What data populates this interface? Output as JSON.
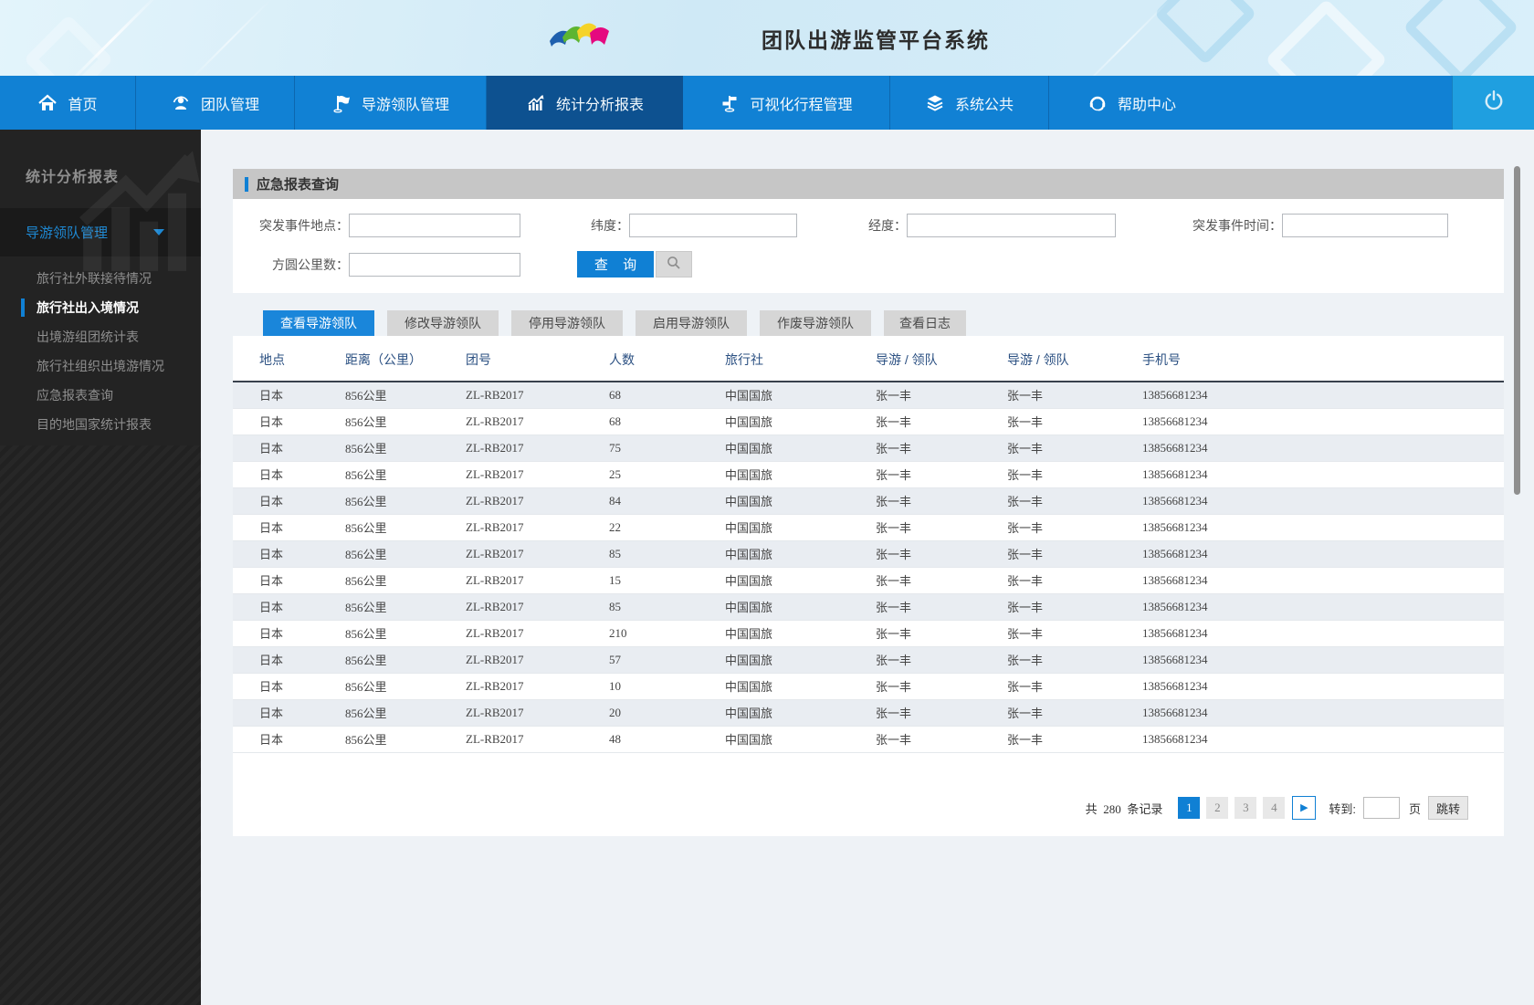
{
  "header": {
    "title": "团队出游监管平台系统"
  },
  "colors": {
    "accent": "#1080d4",
    "navbar": "#1181d4",
    "nav_active": "#0d5190",
    "power_section": "#1f9fe0",
    "sidebar_bg": "#232323",
    "panel_header_bg": "#c6c6c6"
  },
  "nav": {
    "items": [
      {
        "label": "首页",
        "icon": "home-icon",
        "active": false
      },
      {
        "label": "团队管理",
        "icon": "team-icon",
        "active": false
      },
      {
        "label": "导游领队管理",
        "icon": "flag-icon",
        "active": false
      },
      {
        "label": "统计分析报表",
        "icon": "chart-icon",
        "active": true
      },
      {
        "label": "可视化行程管理",
        "icon": "signpost-icon",
        "active": false
      },
      {
        "label": "系统公共",
        "icon": "layers-icon",
        "active": false
      },
      {
        "label": "帮助中心",
        "icon": "headset-icon",
        "active": false
      }
    ]
  },
  "sidebar": {
    "section_title": "统计分析报表",
    "group_label": "导游领队管理",
    "items": [
      {
        "label": "旅行社外联接待情况",
        "active": false
      },
      {
        "label": "旅行社出入境情况",
        "active": true
      },
      {
        "label": "出境游组团统计表",
        "active": false
      },
      {
        "label": "旅行社组织出境游情况",
        "active": false
      },
      {
        "label": "应急报表查询",
        "active": false
      },
      {
        "label": "目的地国家统计报表",
        "active": false
      }
    ]
  },
  "panel": {
    "title": "应急报表查询",
    "form": {
      "fields": [
        {
          "label": "突发事件地点：",
          "value": ""
        },
        {
          "label": "纬度：",
          "value": ""
        },
        {
          "label": "经度：",
          "value": ""
        },
        {
          "label": "突发事件时间：",
          "value": ""
        },
        {
          "label": "方圆公里数：",
          "value": ""
        }
      ],
      "search_button": "查 询"
    }
  },
  "tabs": [
    {
      "label": "查看导游领队",
      "active": true
    },
    {
      "label": "修改导游领队",
      "active": false
    },
    {
      "label": "停用导游领队",
      "active": false
    },
    {
      "label": "启用导游领队",
      "active": false
    },
    {
      "label": "作废导游领队",
      "active": false
    },
    {
      "label": "查看日志",
      "active": false
    }
  ],
  "table": {
    "columns": [
      "地点",
      "距离（公里）",
      "团号",
      "人数",
      "旅行社",
      "导游 / 领队",
      "导游 / 领队",
      "手机号"
    ],
    "rows": [
      [
        "日本",
        "856公里",
        "ZL-RB2017",
        "68",
        "中国国旅",
        "张一丰",
        "张一丰",
        "13856681234"
      ],
      [
        "日本",
        "856公里",
        "ZL-RB2017",
        "68",
        "中国国旅",
        "张一丰",
        "张一丰",
        "13856681234"
      ],
      [
        "日本",
        "856公里",
        "ZL-RB2017",
        "75",
        "中国国旅",
        "张一丰",
        "张一丰",
        "13856681234"
      ],
      [
        "日本",
        "856公里",
        "ZL-RB2017",
        "25",
        "中国国旅",
        "张一丰",
        "张一丰",
        "13856681234"
      ],
      [
        "日本",
        "856公里",
        "ZL-RB2017",
        "84",
        "中国国旅",
        "张一丰",
        "张一丰",
        "13856681234"
      ],
      [
        "日本",
        "856公里",
        "ZL-RB2017",
        "22",
        "中国国旅",
        "张一丰",
        "张一丰",
        "13856681234"
      ],
      [
        "日本",
        "856公里",
        "ZL-RB2017",
        "85",
        "中国国旅",
        "张一丰",
        "张一丰",
        "13856681234"
      ],
      [
        "日本",
        "856公里",
        "ZL-RB2017",
        "15",
        "中国国旅",
        "张一丰",
        "张一丰",
        "13856681234"
      ],
      [
        "日本",
        "856公里",
        "ZL-RB2017",
        "85",
        "中国国旅",
        "张一丰",
        "张一丰",
        "13856681234"
      ],
      [
        "日本",
        "856公里",
        "ZL-RB2017",
        "210",
        "中国国旅",
        "张一丰",
        "张一丰",
        "13856681234"
      ],
      [
        "日本",
        "856公里",
        "ZL-RB2017",
        "57",
        "中国国旅",
        "张一丰",
        "张一丰",
        "13856681234"
      ],
      [
        "日本",
        "856公里",
        "ZL-RB2017",
        "10",
        "中国国旅",
        "张一丰",
        "张一丰",
        "13856681234"
      ],
      [
        "日本",
        "856公里",
        "ZL-RB2017",
        "20",
        "中国国旅",
        "张一丰",
        "张一丰",
        "13856681234"
      ],
      [
        "日本",
        "856公里",
        "ZL-RB2017",
        "48",
        "中国国旅",
        "张一丰",
        "张一丰",
        "13856681234"
      ]
    ]
  },
  "pagination": {
    "total_prefix": "共",
    "total_count": "280",
    "total_suffix": "条记录",
    "pages": [
      "1",
      "2",
      "3",
      "4"
    ],
    "active_page": "1",
    "next_icon": "▶",
    "goto_label": "转到:",
    "page_unit": "页",
    "jump_label": "跳转"
  }
}
